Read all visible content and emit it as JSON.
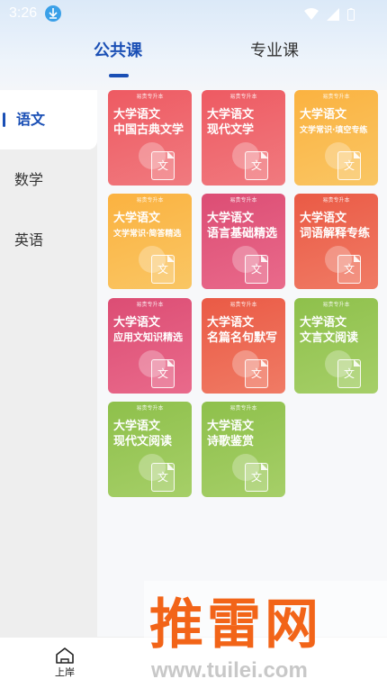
{
  "status_bar": {
    "time": "3:26"
  },
  "tabs": [
    {
      "label": "公共课",
      "active": true
    },
    {
      "label": "专业课",
      "active": false
    }
  ],
  "sidebar": {
    "items": [
      {
        "label": "语文",
        "active": true
      },
      {
        "label": "数学",
        "active": false
      },
      {
        "label": "英语",
        "active": false
      }
    ]
  },
  "cards": [
    {
      "brand": "易贵专升本",
      "title": "大学语文",
      "subtitle": "中国古典文学",
      "doc": "文",
      "color": "#ee5a62"
    },
    {
      "brand": "易贵专升本",
      "title": "大学语文",
      "subtitle": "现代文学",
      "doc": "文",
      "color": "#ee5a62"
    },
    {
      "brand": "易贵专升本",
      "title": "大学语文",
      "subtitle": "文学常识·填空专练",
      "doc": "文",
      "color": "#fbb240"
    },
    {
      "brand": "易贵专升本",
      "title": "大学语文",
      "subtitle": "文学常识·简答精选",
      "doc": "文",
      "color": "#fbb240"
    },
    {
      "brand": "易贵专升本",
      "title": "大学语文",
      "subtitle": "语言基础精选",
      "doc": "文",
      "color": "#dc4d74"
    },
    {
      "brand": "易贵专升本",
      "title": "大学语文",
      "subtitle": "词语解释专练",
      "doc": "文",
      "color": "#ea5a45"
    },
    {
      "brand": "易贵专升本",
      "title": "大学语文",
      "subtitle": "应用文知识精选",
      "doc": "文",
      "color": "#dc4d74"
    },
    {
      "brand": "易贵专升本",
      "title": "大学语文",
      "subtitle": "名篇名句默写",
      "doc": "文",
      "color": "#ea5a45"
    },
    {
      "brand": "易贵专升本",
      "title": "大学语文",
      "subtitle": "文言文阅读",
      "doc": "文",
      "color": "#8ec04b"
    },
    {
      "brand": "易贵专升本",
      "title": "大学语文",
      "subtitle": "现代文阅读",
      "doc": "文",
      "color": "#8ec04b"
    },
    {
      "brand": "易贵专升本",
      "title": "大学语文",
      "subtitle": "诗歌鉴赏",
      "doc": "文",
      "color": "#8ec04b"
    }
  ],
  "bottom_nav": {
    "home_label": "上岸",
    "home_icon": "home-icon"
  },
  "watermark": {
    "text": "推雷网",
    "url": "www.tuilei.com"
  },
  "colors": {
    "accent": "#1a4fb5",
    "watermark": "#f26418"
  }
}
